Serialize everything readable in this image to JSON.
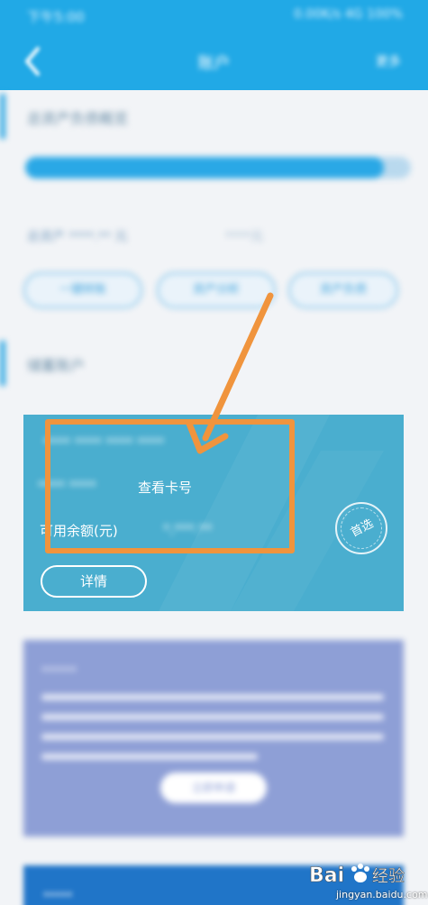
{
  "status_bar": {
    "time": "下午5:00",
    "right": "0.00K/s 4G 100%"
  },
  "navbar": {
    "back_icon": "chevron-left-icon",
    "title": "账户",
    "more": "更多"
  },
  "overview": {
    "title": "总资产负债概览",
    "progress_fraction": 0.93,
    "total_assets_label": "总资产 ****.** 元",
    "total_assets_value": "****元",
    "pills": [
      "一键转账",
      "资产分析",
      "资产负债"
    ]
  },
  "account_section": {
    "title": "储蓄账户"
  },
  "account_card": {
    "account_name": "**** **** **** ****",
    "card_number": "**** ****",
    "view_card_no": "查看卡号",
    "balance_label": "可用余额(元)",
    "balance_value": "*,***.**",
    "detail_button": "详情",
    "preferred_stamp": "首选"
  },
  "promo_card": {
    "title": "******",
    "button": "立即申请"
  },
  "bottom_card": {
    "title": "*****"
  },
  "watermark": {
    "logo_text": "Bai 经验",
    "sub": "jingyan.baidu.com"
  },
  "colors": {
    "header": "#21a9e6",
    "card": "#4aaecf",
    "highlight": "#f0943d",
    "promo": "#8e9fd6"
  }
}
